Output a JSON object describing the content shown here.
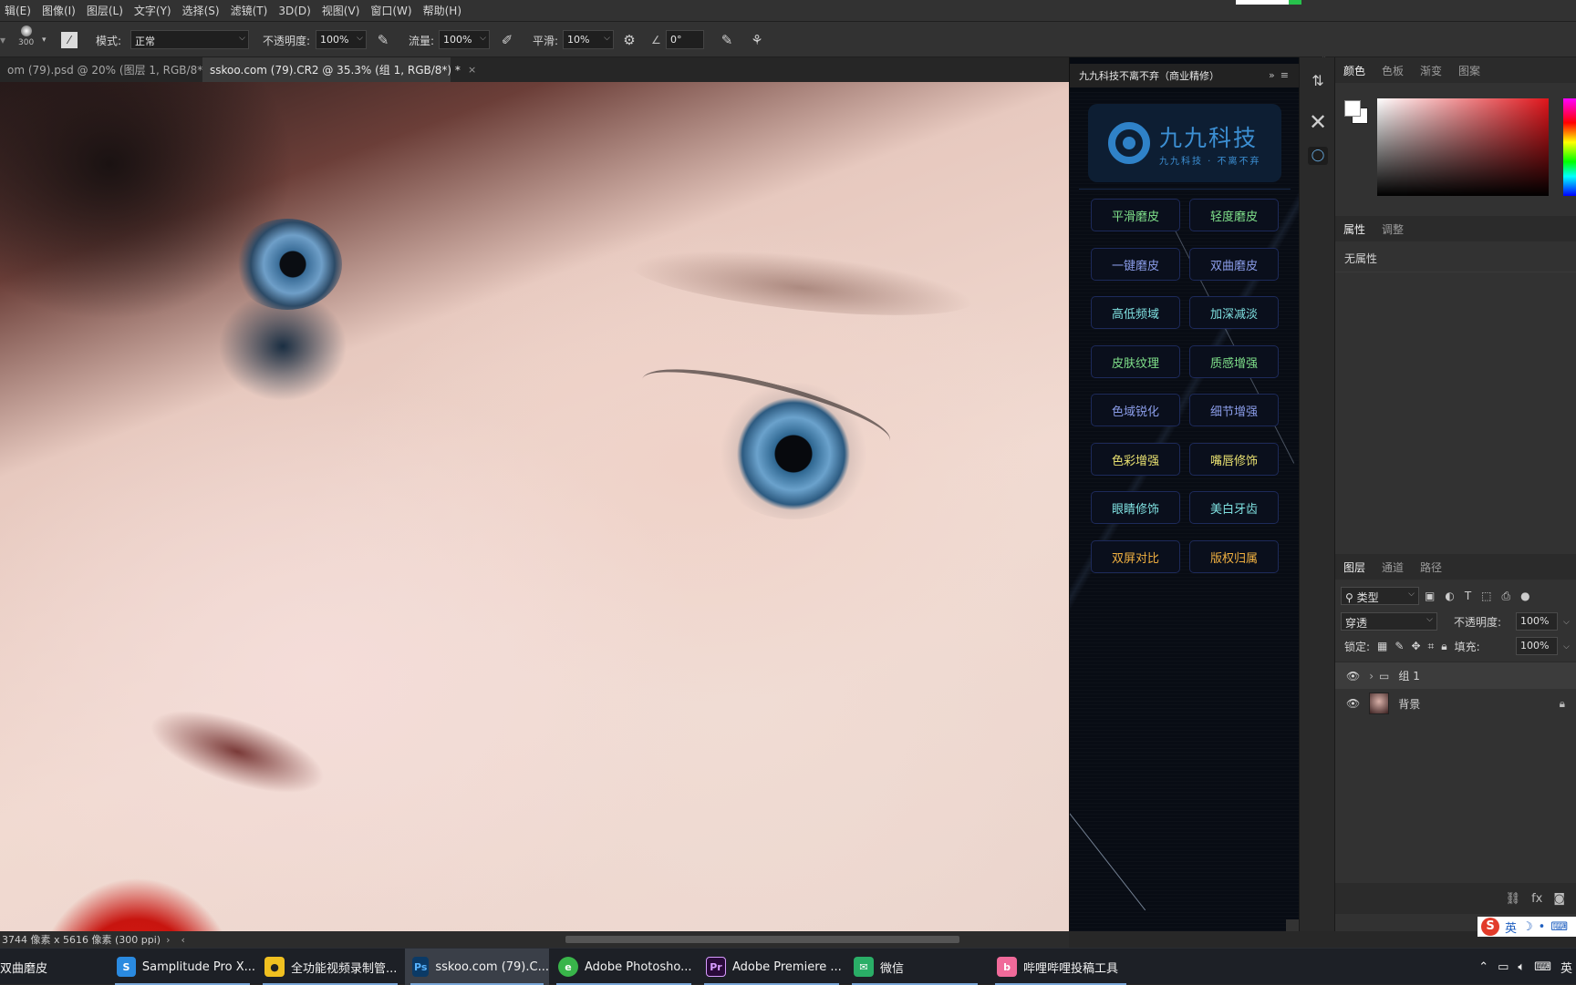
{
  "menu": [
    "辑(E)",
    "图像(I)",
    "图层(L)",
    "文字(Y)",
    "选择(S)",
    "滤镜(T)",
    "3D(D)",
    "视图(V)",
    "窗口(W)",
    "帮助(H)"
  ],
  "options": {
    "brush_size": "300",
    "mode_label": "模式:",
    "mode_value": "正常",
    "opacity_label": "不透明度:",
    "opacity_value": "100%",
    "flow_label": "流量:",
    "flow_value": "100%",
    "smooth_label": "平滑:",
    "smooth_value": "10%",
    "angle_value": "0°"
  },
  "tabs": [
    {
      "label": "om (79).psd @ 20% (图层 1, RGB/8*) *",
      "active": false
    },
    {
      "label": "sskoo.com (79).CR2 @ 35.3% (组 1, RGB/8*) *",
      "active": true
    }
  ],
  "status": {
    "dimensions": "3744 像素 x 5616 像素 (300 ppi)",
    "arrow": "›"
  },
  "plugin": {
    "title": "九九科技不离不弃（商业精修）",
    "logo_title": "九九科技",
    "logo_sub": "九九科技 · 不离不弃",
    "buttons": [
      {
        "label": "平滑磨皮",
        "color": "#7fe08a"
      },
      {
        "label": "轻度磨皮",
        "color": "#7fe08a"
      },
      {
        "label": "一键磨皮",
        "color": "#8a9ce8"
      },
      {
        "label": "双曲磨皮",
        "color": "#8a9ce8"
      },
      {
        "label": "高低频域",
        "color": "#7fe0e0"
      },
      {
        "label": "加深减淡",
        "color": "#7fe0e0"
      },
      {
        "label": "皮肤纹理",
        "color": "#7fe08a"
      },
      {
        "label": "质感增强",
        "color": "#7fe08a"
      },
      {
        "label": "色域锐化",
        "color": "#8a9ce8"
      },
      {
        "label": "细节增强",
        "color": "#8a9ce8"
      },
      {
        "label": "色彩增强",
        "color": "#e8e070"
      },
      {
        "label": "嘴唇修饰",
        "color": "#e8e070"
      },
      {
        "label": "眼睛修饰",
        "color": "#7fe0e0"
      },
      {
        "label": "美白牙齿",
        "color": "#7fe0e0"
      },
      {
        "label": "双屏对比",
        "color": "#f0b040"
      },
      {
        "label": "版权归属",
        "color": "#f0b040"
      }
    ]
  },
  "panels": {
    "color_tabs": [
      "颜色",
      "色板",
      "渐变",
      "图案"
    ],
    "prop_tabs": [
      "属性",
      "调整"
    ],
    "no_props": "无属性",
    "layer_tabs": [
      "图层",
      "通道",
      "路径"
    ],
    "filter_value": "类型",
    "blend_value": "穿透",
    "opacity_label": "不透明度:",
    "opacity_value": "100%",
    "lock_label": "锁定:",
    "fill_label": "填充:",
    "fill_value": "100%",
    "layers": [
      {
        "name": "组 1",
        "type": "group"
      },
      {
        "name": "背景",
        "type": "image"
      }
    ],
    "ime_label": "英"
  },
  "taskbar": [
    {
      "label": "双曲磨皮",
      "icon_color": "#000000",
      "icon": ""
    },
    {
      "label": "Samplitude Pro X...",
      "icon_color": "#2a8ae0",
      "icon": "S"
    },
    {
      "label": "全功能视频录制管...",
      "icon_color": "#f0c020",
      "icon": "●"
    },
    {
      "label": "sskoo.com (79).C...",
      "icon_color": "#0b3a66",
      "icon": "Ps"
    },
    {
      "label": "Adobe Photosho...",
      "icon_color": "#39b54a",
      "icon": "e"
    },
    {
      "label": "Adobe Premiere ...",
      "icon_color": "#2a0a3a",
      "icon": "Pr"
    },
    {
      "label": "微信",
      "icon_color": "#2aae67",
      "icon": "✉"
    },
    {
      "label": "哔哩哔哩投稿工具",
      "icon_color": "#f06a9a",
      "icon": "b"
    }
  ],
  "tray": {
    "trailing": "英"
  }
}
